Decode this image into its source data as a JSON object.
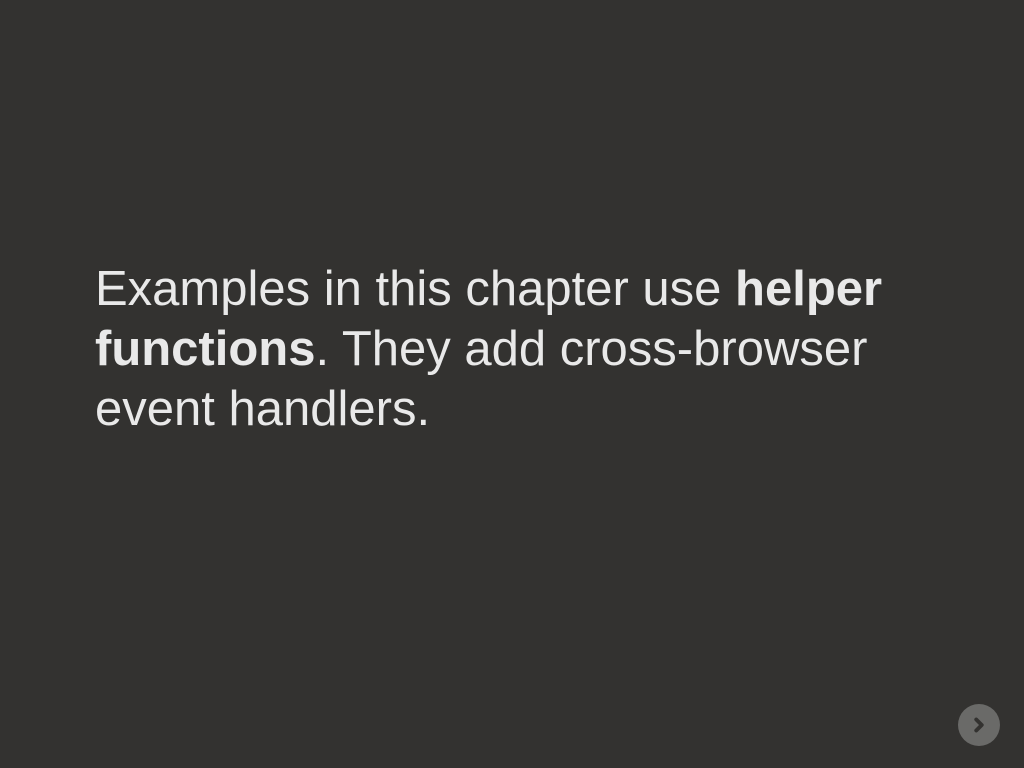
{
  "slide": {
    "text_before_bold": "Examples in this chapter use ",
    "bold_text": "helper functions",
    "text_after_bold": ". They add cross-browser event handlers."
  },
  "controls": {
    "next_label": "Next"
  },
  "colors": {
    "background": "#333230",
    "text": "#e9e9e9",
    "button_bg": "#6a6a68",
    "button_arrow": "#333230"
  }
}
